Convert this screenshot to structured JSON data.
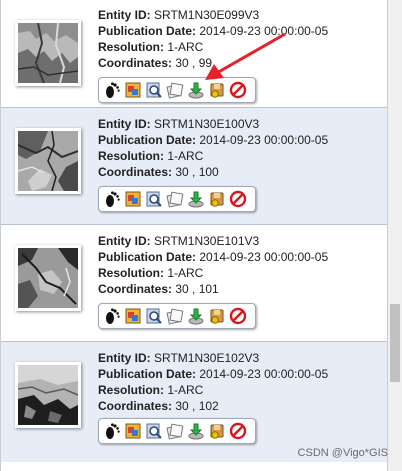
{
  "results": [
    {
      "entity_id": "SRTM1N30E099V3",
      "publication_date": "2014-09-23 00:00:00-05",
      "resolution": "1-ARC",
      "coordinates": "30 , 99"
    },
    {
      "entity_id": "SRTM1N30E100V3",
      "publication_date": "2014-09-23 00:00:00-05",
      "resolution": "1-ARC",
      "coordinates": "30 , 100"
    },
    {
      "entity_id": "SRTM1N30E101V3",
      "publication_date": "2014-09-23 00:00:00-05",
      "resolution": "1-ARC",
      "coordinates": "30 , 101"
    },
    {
      "entity_id": "SRTM1N30E102V3",
      "publication_date": "2014-09-23 00:00:00-05",
      "resolution": "1-ARC",
      "coordinates": "30 , 102"
    }
  ],
  "labels": {
    "entity_id": "Entity ID:",
    "publication_date": "Publication Date:",
    "resolution": "Resolution:",
    "coordinates": "Coordinates:"
  },
  "toolbar_icons": [
    "footprint-icon",
    "browse-overlay-icon",
    "metadata-magnifier-icon",
    "compare-browse-icon",
    "download-icon",
    "bulk-order-icon",
    "exclude-icon"
  ],
  "annotation": {
    "arrow_color": "#e8202a",
    "points_to": "download-icon"
  },
  "watermark": "CSDN @Vigo*GIS"
}
